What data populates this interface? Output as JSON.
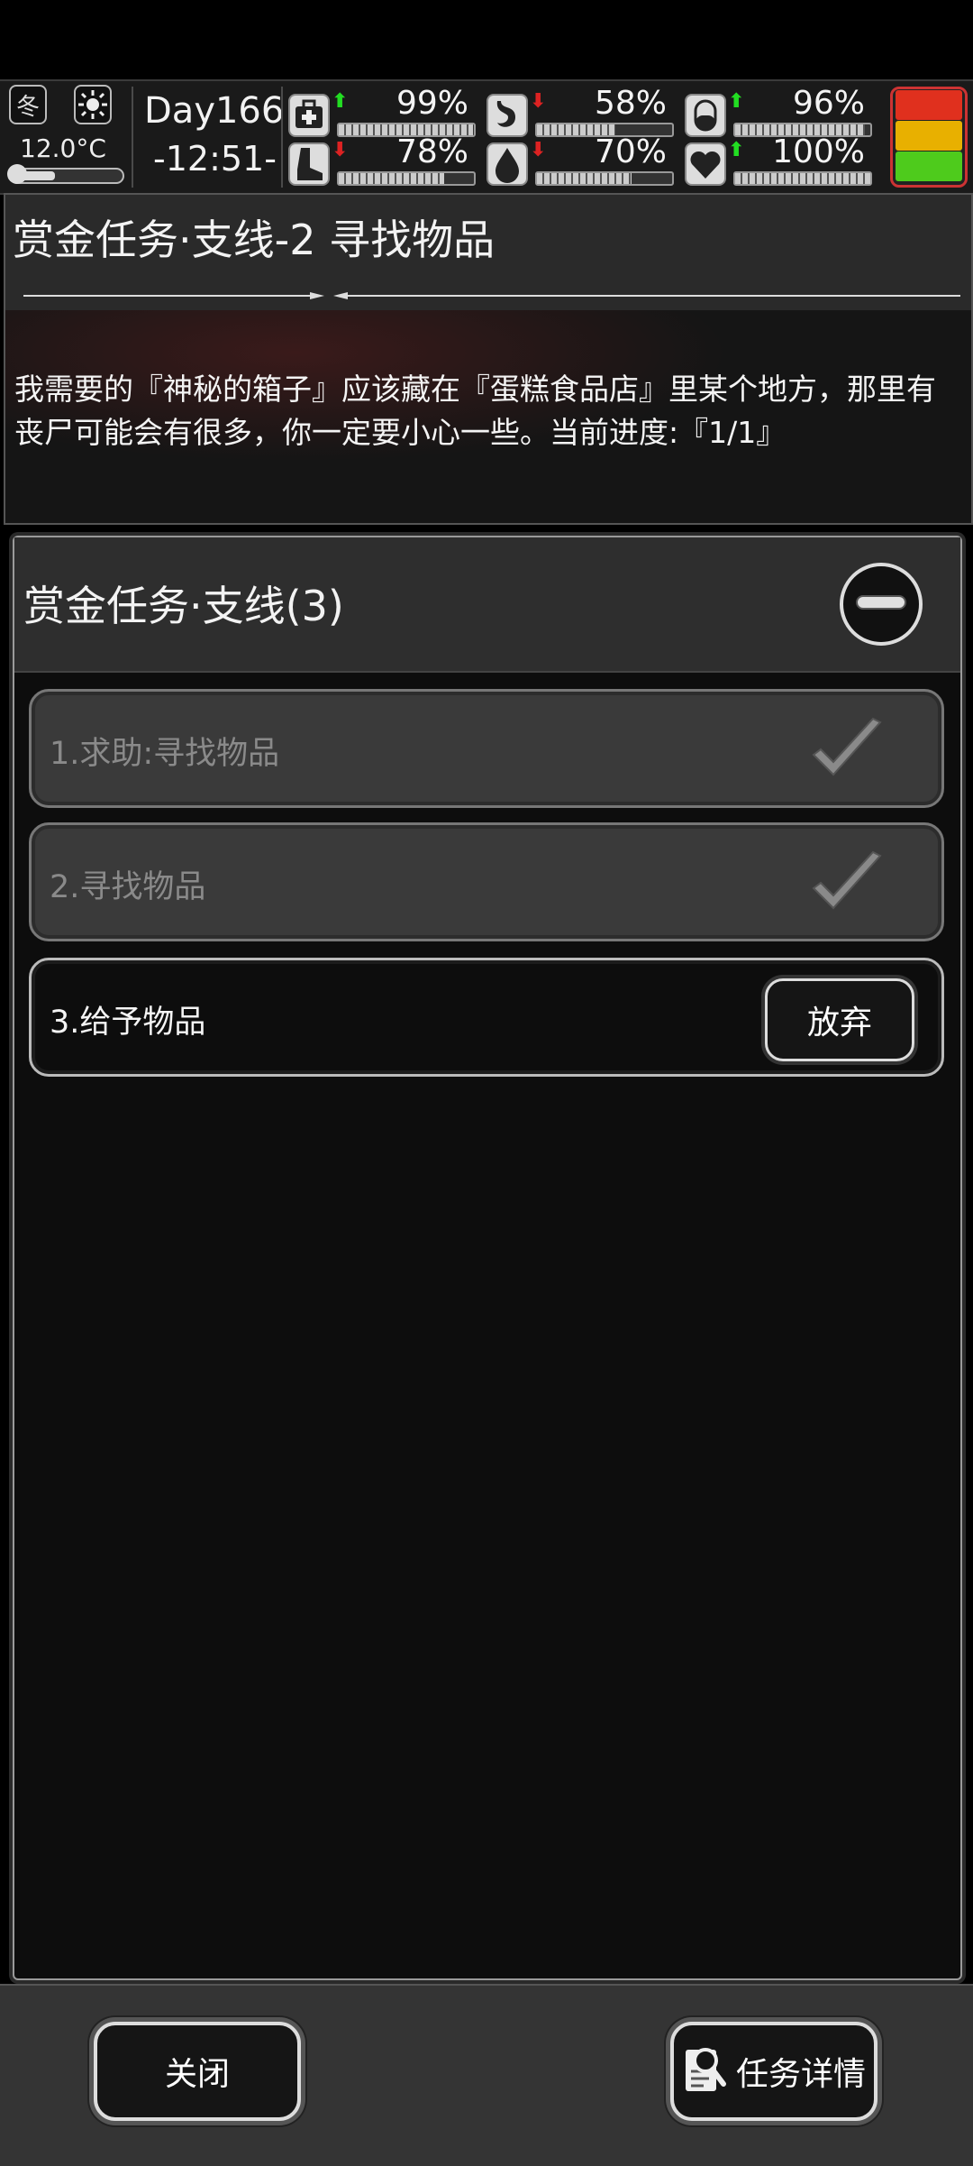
{
  "status": {
    "season": "冬",
    "temperature": "12.0°C",
    "thermometer_level": 0.35,
    "day": "Day166",
    "time": "-12:51-",
    "stats": [
      {
        "name": "health",
        "icon": "medkit-icon",
        "value": "99%",
        "trend": "up",
        "level": 0.99
      },
      {
        "name": "hunger",
        "icon": "stomach-icon",
        "value": "58%",
        "trend": "down",
        "level": 0.58
      },
      {
        "name": "immunity",
        "icon": "pill-icon",
        "value": "96%",
        "trend": "up",
        "level": 0.96
      },
      {
        "name": "stamina",
        "icon": "boot-icon",
        "value": "78%",
        "trend": "down",
        "level": 0.78
      },
      {
        "name": "thirst",
        "icon": "water-drop-icon",
        "value": "70%",
        "trend": "down",
        "level": 0.7
      },
      {
        "name": "mood",
        "icon": "heart-icon",
        "value": "100%",
        "trend": "up",
        "level": 1.0
      }
    ],
    "colors": {
      "up": "#22dd22",
      "down": "#dd2222",
      "alarm_red": "#e0301e",
      "alarm_yellow": "#e8b000",
      "alarm_green": "#4ecb1c"
    }
  },
  "quest": {
    "title": "赏金任务·支线-2 寻找物品",
    "description": "我需要的『神秘的箱子』应该藏在『蛋糕食品店』里某个地方，那里有丧尸可能会有很多，你一定要小心一些。当前进度:『1/1』"
  },
  "list": {
    "title": "赏金任务·支线(3)",
    "tasks": [
      {
        "label": "1.求助:寻找物品",
        "status": "done"
      },
      {
        "label": "2.寻找物品",
        "status": "done"
      },
      {
        "label": "3.给予物品",
        "status": "active",
        "action": "放弃"
      }
    ]
  },
  "footer": {
    "close_label": "关闭",
    "details_label": "任务详情"
  }
}
